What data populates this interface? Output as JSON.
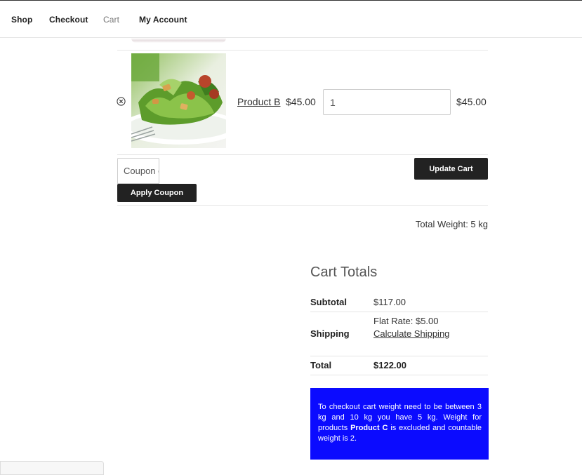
{
  "nav": {
    "items": [
      {
        "label": "Shop"
      },
      {
        "label": "Checkout"
      },
      {
        "label": "Cart"
      },
      {
        "label": "My Account"
      }
    ]
  },
  "cart": {
    "item": {
      "name": "Product B",
      "price": "$45.00",
      "quantity": "1",
      "subtotal": "$45.00",
      "remove_icon": "circle-x-icon"
    },
    "coupon_placeholder": "Coupon code",
    "apply_coupon_label": "Apply Coupon",
    "update_cart_label": "Update Cart",
    "total_weight": "Total Weight: 5 kg"
  },
  "totals": {
    "heading": "Cart Totals",
    "subtotal_label": "Subtotal",
    "subtotal_value": "$117.00",
    "shipping_label": "Shipping",
    "shipping_rate": "Flat Rate: $5.00",
    "calculate_shipping": "Calculate Shipping",
    "total_label": "Total",
    "total_value": "$122.00"
  },
  "notice": {
    "text_before": "To checkout cart weight need to be between 3 kg and 10 kg you have 5 kg. Weight for products ",
    "product": "Product C",
    "text_after": " is excluded and countable weight is 2.",
    "background": "#0b0bff"
  }
}
